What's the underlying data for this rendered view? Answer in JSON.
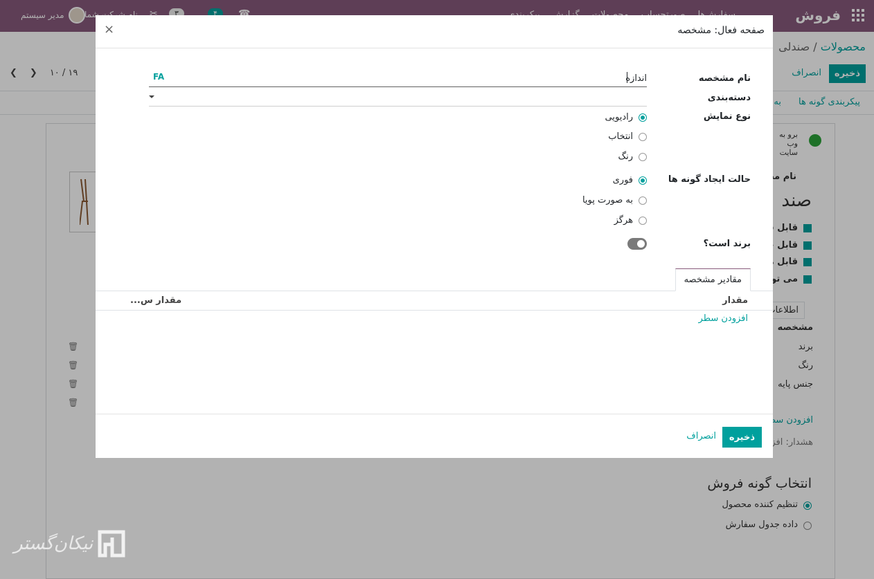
{
  "app": {
    "brand": "فروش",
    "menu": [
      "سفارش‌ها",
      "صورتحساب",
      "محصولات",
      "گزارش",
      "پیکربندی"
    ],
    "user": "مدیر سیستم",
    "company": "نام شرکت شما",
    "badge_activity": "۳",
    "badge_messages": "۴"
  },
  "breadcrumb": {
    "parent": "محصولات",
    "current": "صندلی"
  },
  "toolbar": {
    "save": "ذخیره",
    "discard": "انصراف",
    "pager": "۱۰ / ۱۹"
  },
  "bg_buttons": {
    "variants": "پیکربندی گونه ها",
    "other": "به"
  },
  "bg_form": {
    "website": "برو به وب سایت",
    "product_name_label": "نام محصول",
    "product_name": "صند",
    "checks": [
      "قابل فروش",
      "قابل خرید",
      "قابل هزینه",
      "می توان اجاره داد"
    ],
    "tab": "اطلاعات",
    "attr_header": "مشخصه",
    "attrs": [
      "برند",
      "رنگ",
      "جنس پایه"
    ],
    "add_line": "افزودن سطر",
    "warning": "هشدار: افزودن",
    "section_title": "انتخاب گونه فروش",
    "radio_options": [
      "تنظیم کننده محصول",
      "داده جدول سفارش"
    ]
  },
  "watermark": {
    "text": "نیکان‌گستر"
  },
  "modal": {
    "title": "صفحه فعال: مشخصه",
    "fields": {
      "name_label": "نام مشخصه",
      "name_value": "اندازه",
      "lang": "FA",
      "category_label": "دسته‌بندی",
      "display_label": "نوع نمایش",
      "display_options": [
        "رادیویی",
        "انتخاب",
        "رنگ"
      ],
      "create_label": "حالت ایجاد گونه ها",
      "create_options": [
        "فوری",
        "به صورت پویا",
        "هرگز"
      ],
      "brand_label": "برند است؟"
    },
    "tab": "مقادیر مشخصه",
    "columns": {
      "value": "مقدار",
      "extra": "مقدار س..."
    },
    "add_line": "افزودن سطر",
    "save": "ذخیره",
    "discard": "انصراف"
  }
}
